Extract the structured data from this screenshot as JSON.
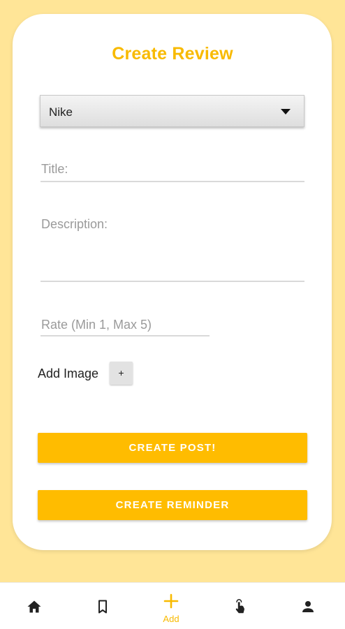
{
  "form": {
    "title": "Create Review",
    "brand_select": {
      "selected": "Nike"
    },
    "title_field": {
      "placeholder": "Title:"
    },
    "description_field": {
      "placeholder": "Description:"
    },
    "rate_field": {
      "placeholder": "Rate (Min 1, Max 5)"
    },
    "add_image": {
      "label": "Add Image",
      "button_symbol": "+"
    },
    "create_post_label": "CREATE POST!",
    "create_reminder_label": "CREATE REMINDER"
  },
  "bottom_nav": {
    "items": [
      {
        "icon": "home-icon",
        "label": ""
      },
      {
        "icon": "bookmark-icon",
        "label": ""
      },
      {
        "icon": "plus-icon",
        "label": "Add",
        "active": true
      },
      {
        "icon": "touch-icon",
        "label": ""
      },
      {
        "icon": "person-icon",
        "label": ""
      }
    ]
  },
  "colors": {
    "background": "#FFE597",
    "accent": "#FFBC00",
    "title": "#F8BA00"
  }
}
